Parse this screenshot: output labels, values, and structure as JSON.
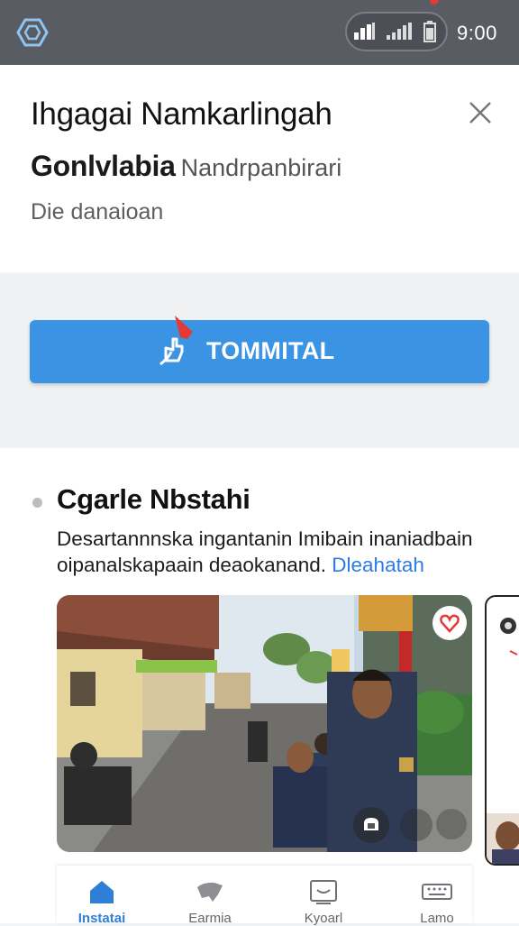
{
  "status_bar": {
    "time": "9:00",
    "icons": [
      "app-logo-icon",
      "signal-icon",
      "signal-bars-icon",
      "battery-icon"
    ]
  },
  "header": {
    "title": "Ihgagai Namkarlingah",
    "subtitle_main": "Gonlvlabia",
    "subtitle_secondary": "Nandrpanbirari",
    "caption": "Die danaioan",
    "close_icon": "close-icon"
  },
  "cta": {
    "label": "TOMMITAL",
    "icon": "hand-tap-icon"
  },
  "section": {
    "title": "Cgarle Nbstahi",
    "description": "Desartannnska ingantanin Imibain inaniadbain oipanalskapaain deaokanand.",
    "link_text": "Dleahatah"
  },
  "photo_card": {
    "badge_icon": "heart-icon",
    "overlay_icons": [
      "camera-icon",
      "share-icon",
      "more-icon"
    ]
  },
  "bottom_nav": {
    "items": [
      {
        "label": "Instatai",
        "icon": "home-icon",
        "active": true
      },
      {
        "label": "Earmia",
        "icon": "explore-icon",
        "active": false
      },
      {
        "label": "Kyoarl",
        "icon": "media-icon",
        "active": false
      },
      {
        "label": "Lamo",
        "icon": "keyboard-icon",
        "active": false
      }
    ]
  },
  "colors": {
    "accent": "#3b93e4",
    "status_bar": "#5a5c63",
    "link": "#2c7be5",
    "nav_active": "#2f7fd6"
  }
}
